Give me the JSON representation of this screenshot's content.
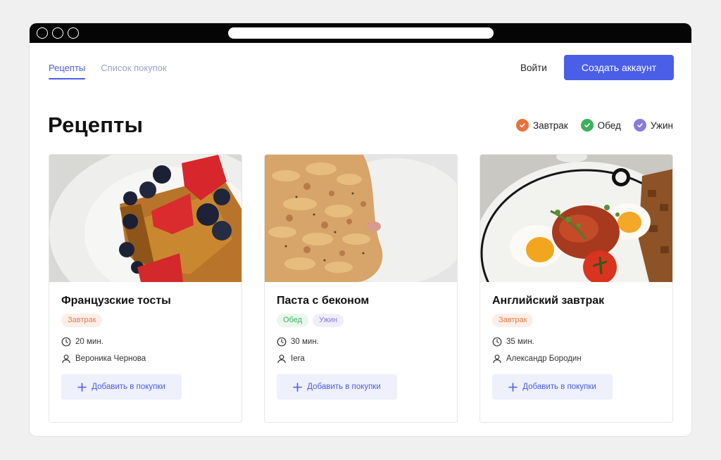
{
  "nav": {
    "tabs": [
      {
        "label": "Рецепты",
        "active": true
      },
      {
        "label": "Список покупок",
        "active": false
      }
    ],
    "login_label": "Войти",
    "signup_label": "Создать аккаунт"
  },
  "page": {
    "title": "Рецепты"
  },
  "filters": [
    {
      "label": "Завтрак",
      "color": "#e8733a",
      "checked": true
    },
    {
      "label": "Обед",
      "color": "#3bb25a",
      "checked": true
    },
    {
      "label": "Ужин",
      "color": "#8a7ad8",
      "checked": true
    }
  ],
  "recipes": [
    {
      "title": "Французские тосты",
      "tags": [
        "Завтрак"
      ],
      "time": "20 мин.",
      "author": "Вероника Чернова",
      "add_label": "Добавить в покупки",
      "photo_icon": "french-toast-photo"
    },
    {
      "title": "Паста с беконом",
      "tags": [
        "Обед",
        "Ужин"
      ],
      "time": "30 мин.",
      "author": "Iera",
      "add_label": "Добавить в покупки",
      "photo_icon": "pasta-photo"
    },
    {
      "title": "Английский завтрак",
      "tags": [
        "Завтрак"
      ],
      "time": "35 мин.",
      "author": "Александр Бородин",
      "add_label": "Добавить в покупки",
      "photo_icon": "english-breakfast-photo"
    }
  ],
  "colors": {
    "accent": "#4a5ee8",
    "tag_breakfast": "#e87a4c",
    "tag_lunch": "#3bb25a",
    "tag_dinner": "#8a7ad8"
  }
}
